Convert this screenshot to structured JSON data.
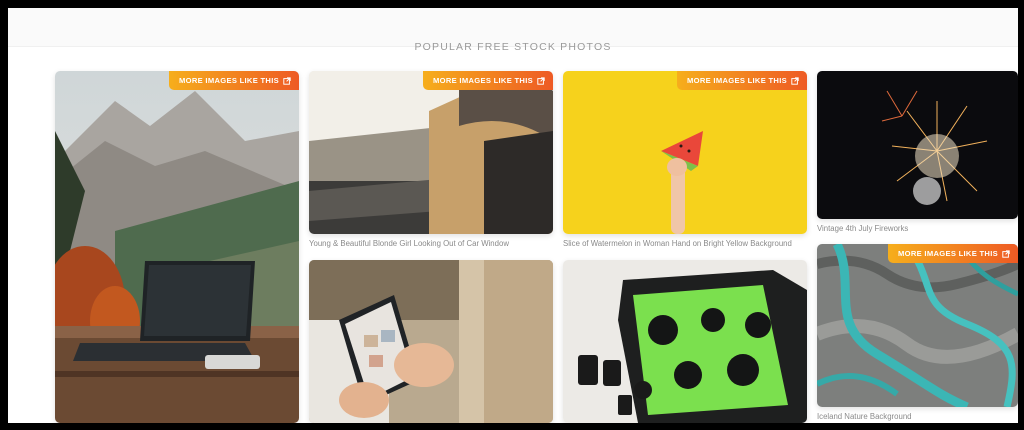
{
  "section": {
    "title": "POPULAR FREE STOCK PHOTOS"
  },
  "badge_label": "MORE IMAGES LIKE THIS",
  "photos": [
    {
      "caption": "",
      "alt": "Laptop on wooden railing with mountain view"
    },
    {
      "caption": "Young & Beautiful Blonde Girl Looking Out of Car Window"
    },
    {
      "caption": "Slice of Watermelon in Woman Hand on Bright Yellow Background"
    },
    {
      "caption": "Vintage 4th July Fireworks"
    },
    {
      "caption": "",
      "alt": "Hands holding smartphone"
    },
    {
      "caption": "",
      "alt": "Camera bag with lenses"
    },
    {
      "caption": "Iceland Nature Background"
    }
  ],
  "colors": {
    "badge_start": "#f6ae1c",
    "badge_end": "#ee5a24",
    "yellow_bg": "#f6d21c"
  }
}
